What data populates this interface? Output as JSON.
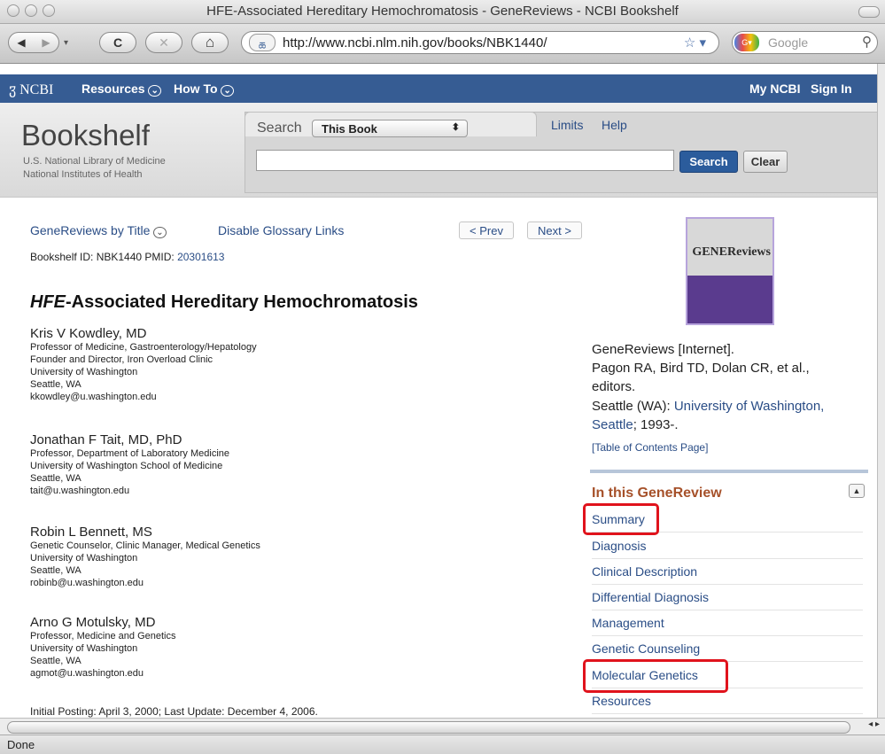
{
  "window": {
    "title": "HFE-Associated Hereditary Hemochromatosis - GeneReviews - NCBI Bookshelf"
  },
  "toolbar": {
    "back_glyph": "◀",
    "forward_glyph": "▶",
    "reload_glyph": "C",
    "stop_glyph": "✕",
    "home_glyph": "⌂",
    "url": "http://www.ncbi.nlm.nih.gov/books/NBK1440/",
    "bookmark_star": "☆ ▾",
    "search_placeholder": "Google",
    "search_glyph": "⚲"
  },
  "ncbi_bar": {
    "logo": "NCBI",
    "resources": "Resources",
    "howto": "How To",
    "my_ncbi": "My NCBI",
    "sign_in": "Sign In",
    "color": "#365c93"
  },
  "bookshelf": {
    "title": "Bookshelf",
    "sub1": "U.S. National Library of Medicine",
    "sub2": "National Institutes of Health",
    "search_label": "Search",
    "select_value": "This Book",
    "limits": "Limits",
    "help": "Help",
    "search_button": "Search",
    "clear_button": "Clear"
  },
  "content": {
    "genereviews_by_title": "GeneReviews by Title",
    "disable_glossary": "Disable Glossary Links",
    "prev": "< Prev",
    "next": "Next >",
    "bookshelf_id_prefix": "Bookshelf ID: NBK1440 PMID: ",
    "pmid": "20301613",
    "title_italic": "HFE",
    "title_rest": "-Associated Hereditary Hemochromatosis",
    "authors": [
      {
        "name": "Kris V Kowdley, MD",
        "lines": [
          "Professor of Medicine, Gastroenterology/Hepatology",
          "Founder and Director, Iron Overload Clinic",
          "University of Washington",
          "Seattle, WA"
        ],
        "email": "kkowdley@u.washington.edu"
      },
      {
        "name": "Jonathan F Tait, MD, PhD",
        "lines": [
          "Professor, Department of Laboratory Medicine",
          "University of Washington School of Medicine",
          "Seattle, WA"
        ],
        "email": "tait@u.washington.edu"
      },
      {
        "name": "Robin L Bennett, MS",
        "lines": [
          "Genetic Counselor, Clinic Manager, Medical Genetics",
          "University of Washington",
          "Seattle, WA"
        ],
        "email": "robinb@u.washington.edu"
      },
      {
        "name": "Arno G Motulsky, MD",
        "lines": [
          "Professor, Medicine and Genetics",
          "University of Washington",
          "Seattle, WA"
        ],
        "email": "agmot@u.washington.edu"
      }
    ],
    "posting": "Initial Posting: April 3, 2000; Last Update: December 4, 2006."
  },
  "book_info": {
    "cover_logo": "GENEReviews",
    "line1": "GeneReviews [Internet].",
    "line2": "Pagon RA, Bird TD, Dolan CR, et al.,",
    "line3": "editors.",
    "line4_prefix": "Seattle (WA): ",
    "line4_link": "University of Washington,",
    "line5_link": "Seattle",
    "line5_suffix": "; 1993-.",
    "toc_page": "[Table of Contents Page]"
  },
  "toc": {
    "heading": "In this GeneReview",
    "up_glyph": "▲",
    "items": [
      "Summary",
      "Diagnosis",
      "Clinical Description",
      "Differential Diagnosis",
      "Management",
      "Genetic Counseling",
      "Molecular Genetics",
      "Resources"
    ],
    "highlight_color": "#e0131c"
  },
  "status": {
    "text": "Done"
  }
}
